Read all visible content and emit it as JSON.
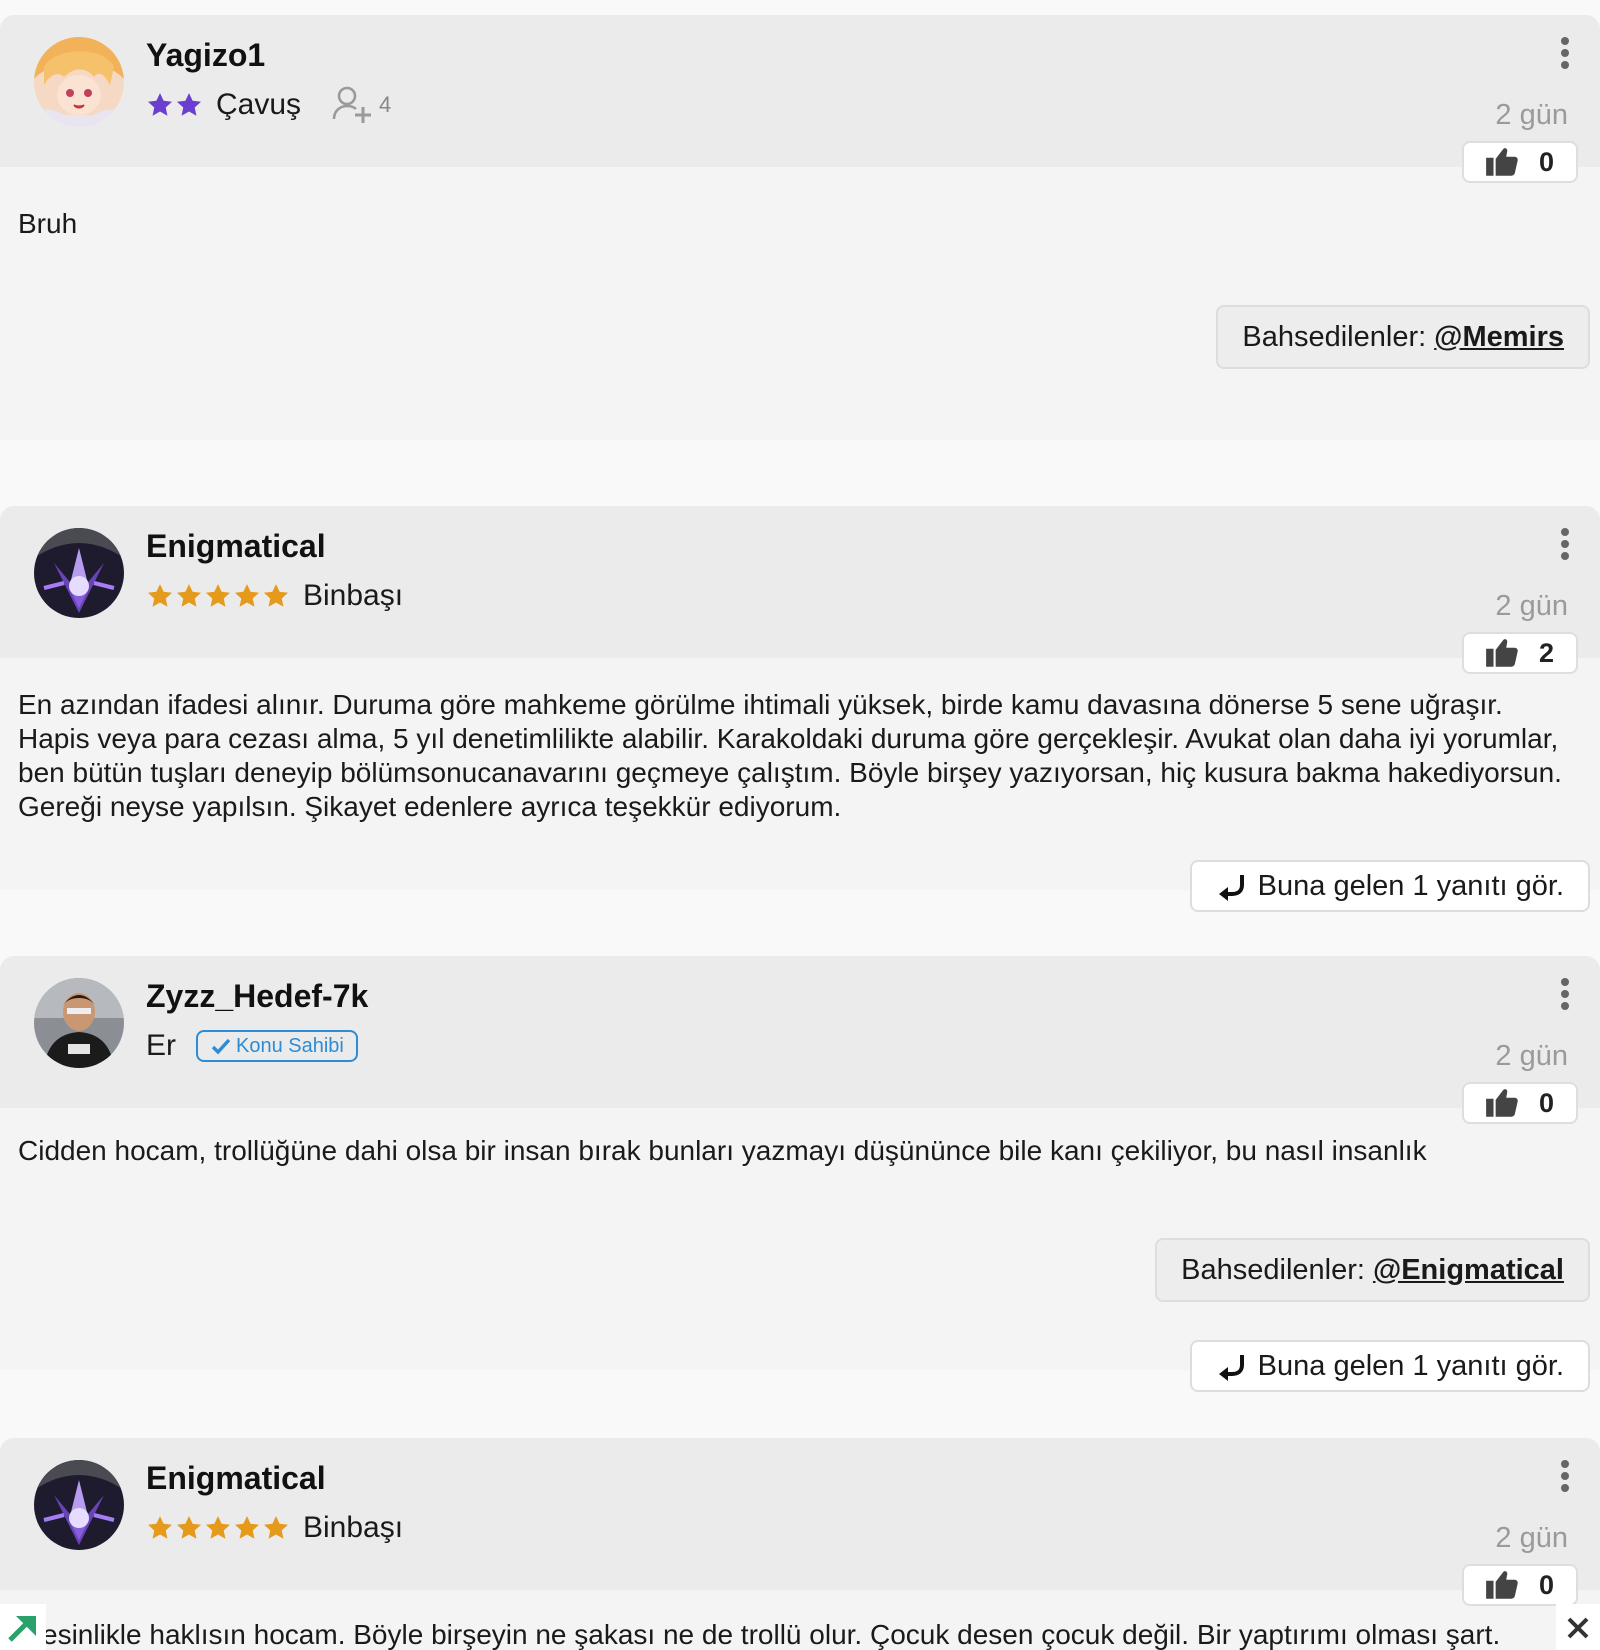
{
  "colors": {
    "header_bg": "#ebebeb",
    "post_bg": "#f4f4f4",
    "page_bg": "#f9f9f9",
    "purple_star": "#6a3fd0",
    "gold_star": "#e59a1c",
    "owner_badge": "#2c8cd6",
    "muted_text": "#9a9a9a"
  },
  "posts": [
    {
      "username": "Yagizo1",
      "rank": "Çavuş",
      "star_color": "purple",
      "star_count": 2,
      "follow_count": "4",
      "time": "2 gün",
      "likes": "0",
      "text": "Bruh",
      "mention_label": "Bahsedilenler:",
      "mention_user": "@Memirs",
      "reply_label": ""
    },
    {
      "username": "Enigmatical",
      "rank": "Binbaşı",
      "star_color": "gold",
      "star_count": 5,
      "time": "2 gün",
      "likes": "2",
      "text": "En azından ifadesi alınır. Duruma göre mahkeme görülme ihtimali yüksek, birde kamu davasına dönerse 5 sene uğraşır. Hapis veya para cezası alma, 5 yıl denetimlilikte alabilir. Karakoldaki duruma göre gerçekleşir. Avukat olan daha iyi yorumlar, ben bütün tuşları deneyip bölümsonucanavarını geçmeye çalıştım. Böyle birşey yazıyorsan, hiç kusura bakma hakediyorsun. Gereği neyse yapılsın. Şikayet edenlere ayrıca teşekkür ediyorum.",
      "reply_label": "Buna gelen 1 yanıtı gör."
    },
    {
      "username": "Zyzz_Hedef-7k",
      "rank": "Er",
      "badge": "Konu Sahibi",
      "time": "2 gün",
      "likes": "0",
      "text": "Cidden hocam, trollüğüne dahi olsa bir insan bırak bunları yazmayı düşününce bile kanı çekiliyor, bu nasıl insanlık",
      "mention_label": "Bahsedilenler:",
      "mention_user": "@Enigmatical",
      "reply_label": "Buna gelen 1 yanıtı gör."
    },
    {
      "username": "Enigmatical",
      "rank": "Binbaşı",
      "star_color": "gold",
      "star_count": 5,
      "time": "2 gün",
      "likes": "0",
      "text": "esinlikle haklısın hocam. Böyle birşeyin ne şakası ne de trollü olur. Çocuk desen çocuk değil. Bir yaptırımı olması şart."
    }
  ]
}
